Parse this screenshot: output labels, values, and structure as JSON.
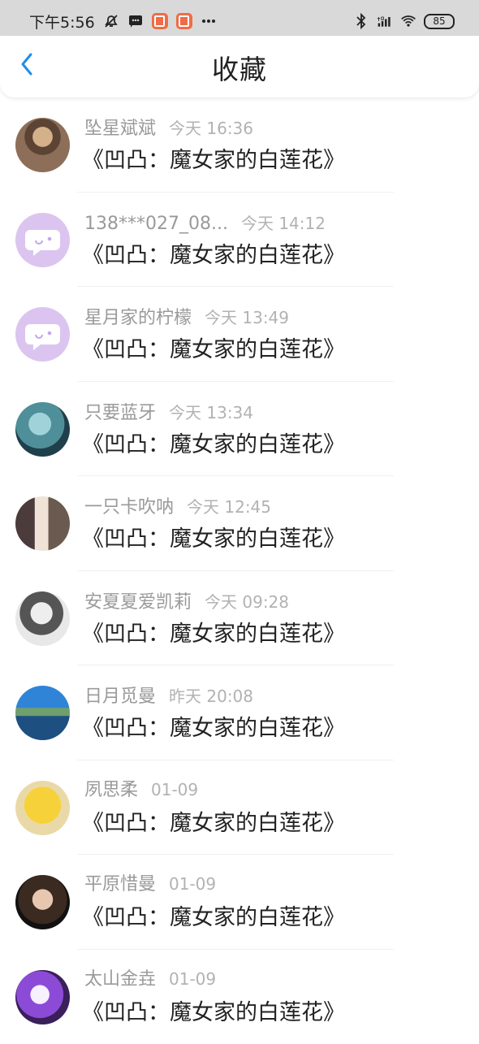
{
  "status_bar": {
    "time": "下午5:56",
    "icons": [
      "mute-icon",
      "message-icon",
      "app-icon",
      "app-icon",
      "more-icon",
      "bluetooth-icon",
      "hd-signal-icon",
      "wifi-icon",
      "battery-icon"
    ],
    "battery": "85"
  },
  "header": {
    "title": "收藏"
  },
  "items": [
    {
      "name": "坠星斌斌",
      "time": "今天 16:36",
      "title": "《凹凸：魔女家的白莲花》",
      "avatar": "photo-avatar"
    },
    {
      "name": "138***027_08...",
      "time": "今天 14:12",
      "title": "《凹凸：魔女家的白莲花》",
      "avatar": "chat-avatar"
    },
    {
      "name": "星月家的柠檬",
      "time": "今天 13:49",
      "title": "《凹凸：魔女家的白莲花》",
      "avatar": "chat-avatar"
    },
    {
      "name": "只要蓝牙",
      "time": "今天 13:34",
      "title": "《凹凸：魔女家的白莲花》",
      "avatar": "anime-avatar"
    },
    {
      "name": "一只卡吹呐",
      "time": "今天 12:45",
      "title": "《凹凸：魔女家的白莲花》",
      "avatar": "anime-avatar"
    },
    {
      "name": "安夏夏爱凯莉",
      "time": "今天 09:28",
      "title": "《凹凸：魔女家的白莲花》",
      "avatar": "anime-avatar"
    },
    {
      "name": "日月觅曼",
      "time": "昨天 20:08",
      "title": "《凹凸：魔女家的白莲花》",
      "avatar": "landscape-avatar"
    },
    {
      "name": "夙思柔",
      "time": "01-09",
      "title": "《凹凸：魔女家的白莲花》",
      "avatar": "anime-avatar"
    },
    {
      "name": "平原惜曼",
      "time": "01-09",
      "title": "《凹凸：魔女家的白莲花》",
      "avatar": "photo-avatar"
    },
    {
      "name": "太山金垚",
      "time": "01-09",
      "title": "《凹凸：魔女家的白莲花》",
      "avatar": "photo-avatar"
    }
  ]
}
